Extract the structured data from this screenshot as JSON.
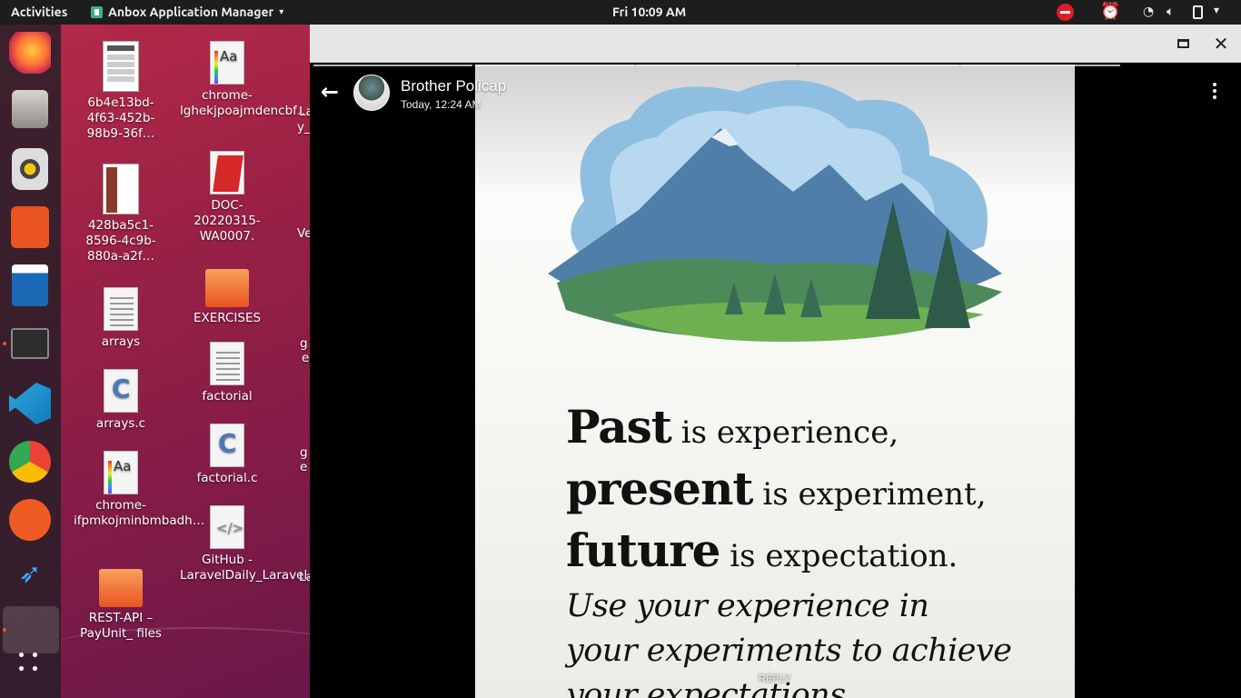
{
  "topbar": {
    "activities": "Activities",
    "app_name": "Anbox Application Manager",
    "clock": "Fri 10:09 AM"
  },
  "dock": {
    "items": [
      "firefox-icon",
      "files-icon",
      "rhythmbox-icon",
      "software-icon",
      "writer-icon",
      "terminal-icon",
      "vscode-icon",
      "chrome-icon",
      "postman-icon",
      "kingfisher-icon",
      "anbox-icon",
      "app-grid-icon"
    ]
  },
  "desktop": {
    "col1": [
      {
        "label": "6b4e13bd-4f63-452b-98b9-36f…",
        "icon": "document-thumbnail-icon"
      },
      {
        "label": "428ba5c1-8596-4c9b-880a-a2f…",
        "icon": "document-thumbnail-icon"
      },
      {
        "label": "arrays",
        "icon": "text-file-icon"
      },
      {
        "label": "arrays.c",
        "icon": "c-file-icon"
      },
      {
        "label": "chrome-ifpmkojminbmbadh…",
        "icon": "font-file-icon"
      },
      {
        "label": "REST-API – PayUnit_ files",
        "icon": "folder-icon"
      }
    ],
    "col2": [
      {
        "label": "chrome-lghekjpoajmdencbf…",
        "icon": "font-file-icon"
      },
      {
        "label": "DOC-20220315-WA0007.",
        "icon": "pdf-file-icon"
      },
      {
        "label": "EXERCISES",
        "icon": "folder-icon"
      },
      {
        "label": "factorial",
        "icon": "text-file-icon"
      },
      {
        "label": "factorial.c",
        "icon": "c-file-icon"
      },
      {
        "label": "GitHub - LaravelDaily_Laravel…",
        "icon": "html-file-icon"
      }
    ],
    "partials": [
      "La",
      "y_",
      "Ve",
      "g",
      "e",
      "g",
      "e",
      "La"
    ]
  },
  "window": {
    "story": {
      "sender": "Brother Policap",
      "time": "Today, 12:24 AM",
      "quote_lines": [
        {
          "bold": "Past",
          "rest": " is experience,"
        },
        {
          "bold": "present",
          "rest": " is experiment,"
        },
        {
          "bold": "future",
          "rest": " is expectation."
        }
      ],
      "italic_lines": [
        "Use your experience in",
        "your experiments to achieve",
        "your expectations."
      ],
      "reply": "REPLY"
    }
  },
  "colors": {
    "accent": "#e95420",
    "topbar": "#1d1d1d",
    "titlebar": "#e6e6e6"
  }
}
